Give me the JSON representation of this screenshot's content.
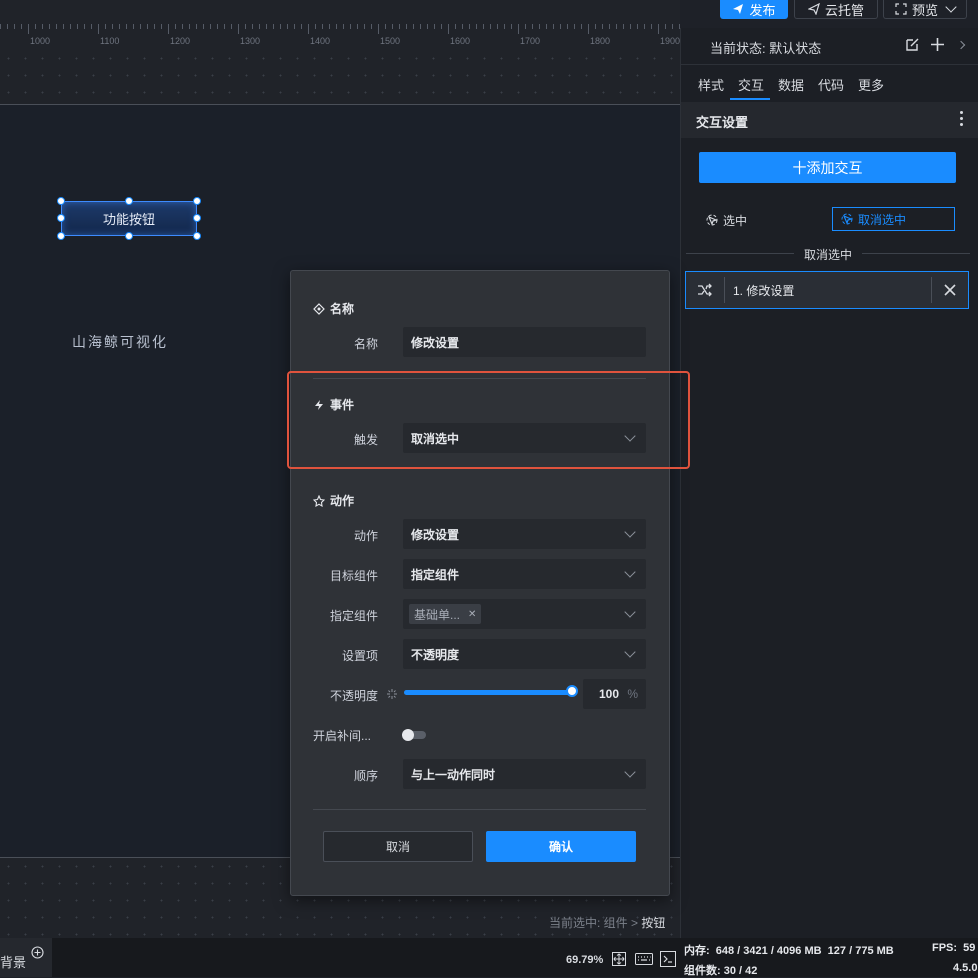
{
  "toolbar": {
    "publish_label": "发布",
    "cloud_label": "云托管",
    "preview_label": "预览"
  },
  "ruler": {
    "ticks": [
      "1000",
      "1100",
      "1200",
      "1300",
      "1400",
      "1500",
      "1600",
      "1700",
      "1800",
      "1900"
    ]
  },
  "canvas": {
    "button_text": "功能按钮",
    "brand_text": "山海鲸可视化",
    "selection_text": "当前选中: 组件 > ",
    "selection_current": "按钮"
  },
  "panel": {
    "state_label": "当前状态: 默认状态",
    "tabs": [
      "样式",
      "交互",
      "数据",
      "代码",
      "更多"
    ],
    "active_tab": "交互",
    "section_title": "交互设置",
    "add_button": "十添加交互",
    "trigger_selected": "选中",
    "trigger_deselected": "取消选中",
    "group_title": "取消选中",
    "interaction_item": "1. 修改设置"
  },
  "dialog": {
    "name_section": "名称",
    "name_label": "名称",
    "name_value": "修改设置",
    "event_section": "事件",
    "trigger_label": "触发",
    "trigger_value": "取消选中",
    "action_section": "动作",
    "action_label": "动作",
    "action_value": "修改设置",
    "target_label": "目标组件",
    "target_value": "指定组件",
    "specified_label": "指定组件",
    "specified_tag": "基础单...",
    "setting_label": "设置项",
    "setting_value": "不透明度",
    "opacity_label": "不透明度",
    "opacity_value": "100",
    "opacity_unit": "%",
    "opacity_fraction": 1.0,
    "tween_label": "开启补间...",
    "order_label": "顺序",
    "order_value": "与上一动作同时",
    "cancel_label": "取消",
    "confirm_label": "确认"
  },
  "status": {
    "background_label": "背景",
    "zoom": "69.79%",
    "memory": "内存:  648 / 3421 / 4096 MB  127 / 775 MB",
    "components": "组件数: 30 / 42",
    "fps": "FPS:  59",
    "version": "4.5.0"
  },
  "colors": {
    "accent": "#1a8cff",
    "highlight_box": "#e0533d",
    "dialog_bg": "#2f3237",
    "panel_bg": "#1c1f25"
  }
}
